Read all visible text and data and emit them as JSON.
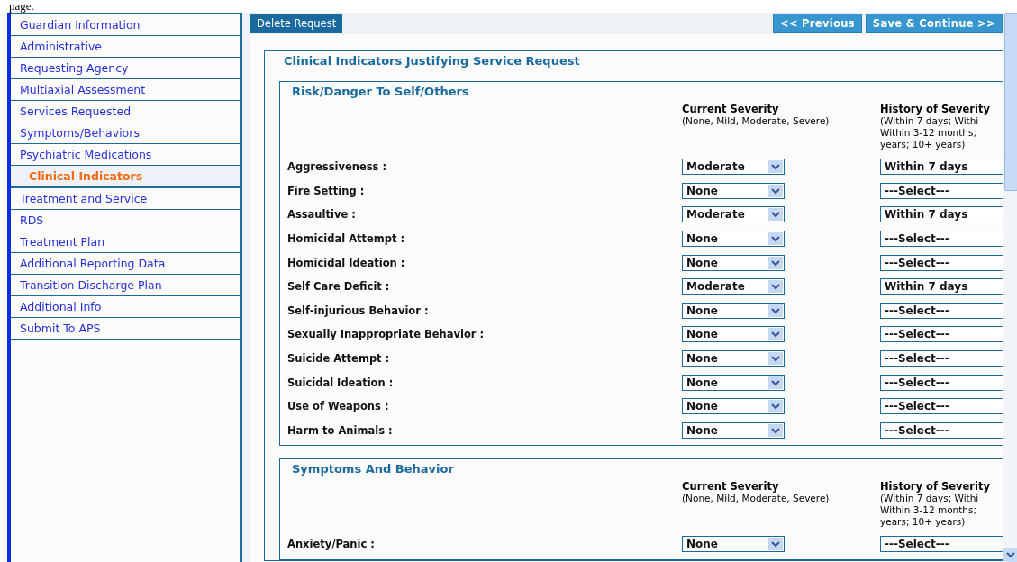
{
  "document_text": "page.",
  "nav": {
    "items": [
      {
        "label": "Guardian Information",
        "selected": false
      },
      {
        "label": "Administrative",
        "selected": false
      },
      {
        "label": "Requesting Agency",
        "selected": false
      },
      {
        "label": "Multiaxial Assessment",
        "selected": false
      },
      {
        "label": "Services Requested",
        "selected": false
      },
      {
        "label": "Symptoms/Behaviors",
        "selected": false
      },
      {
        "label": "Psychiatric Medications",
        "selected": false
      },
      {
        "label": "Clinical Indicators",
        "selected": true
      },
      {
        "label": "Treatment and Service",
        "selected": false
      },
      {
        "label": "RDS",
        "selected": false
      },
      {
        "label": "Treatment Plan",
        "selected": false
      },
      {
        "label": "Additional Reporting Data",
        "selected": false
      },
      {
        "label": "Transition Discharge Plan",
        "selected": false
      },
      {
        "label": "Additional Info",
        "selected": false
      },
      {
        "label": "Submit To APS",
        "selected": false
      }
    ]
  },
  "toolbar": {
    "delete": "Delete Request",
    "previous": "<< Previous",
    "save": "Save & Continue >>"
  },
  "form": {
    "title": "Clinical Indicators Justifying Service Request",
    "sections": [
      {
        "title": "Risk/Danger To Self/Others",
        "current_header": "Current Severity",
        "current_hint": "(None, Mild, Moderate, Severe)",
        "history_header": "History of Severity",
        "history_hint": [
          "(Within 7 days; Withi",
          "Within 3-12 months;",
          "years; 10+ years)"
        ],
        "rows": [
          {
            "label": "Aggressiveness :",
            "current": "Moderate",
            "history": "Within 7 days"
          },
          {
            "label": "Fire Setting :",
            "current": "None",
            "history": "---Select---"
          },
          {
            "label": "Assaultive :",
            "current": "Moderate",
            "history": "Within 7 days"
          },
          {
            "label": "Homicidal Attempt :",
            "current": "None",
            "history": "---Select---"
          },
          {
            "label": "Homicidal Ideation :",
            "current": "None",
            "history": "---Select---"
          },
          {
            "label": "Self Care Deficit :",
            "current": "Moderate",
            "history": "Within 7 days"
          },
          {
            "label": "Self-injurious Behavior :",
            "current": "None",
            "history": "---Select---"
          },
          {
            "label": "Sexually Inappropriate Behavior :",
            "current": "None",
            "history": "---Select---"
          },
          {
            "label": "Suicide Attempt :",
            "current": "None",
            "history": "---Select---"
          },
          {
            "label": "Suicidal Ideation :",
            "current": "None",
            "history": "---Select---"
          },
          {
            "label": "Use of Weapons :",
            "current": "None",
            "history": "---Select---"
          },
          {
            "label": "Harm to Animals :",
            "current": "None",
            "history": "---Select---"
          }
        ]
      },
      {
        "title": "Symptoms And Behavior",
        "current_header": "Current Severity",
        "current_hint": "(None, Mild, Moderate, Severe)",
        "history_header": "History of Severity",
        "history_hint": [
          "(Within 7 days; Withi",
          "Within 3-12 months;",
          "years; 10+ years)"
        ],
        "rows": [
          {
            "label": "Anxiety/Panic :",
            "current": "None",
            "history": "---Select---"
          }
        ]
      }
    ]
  }
}
